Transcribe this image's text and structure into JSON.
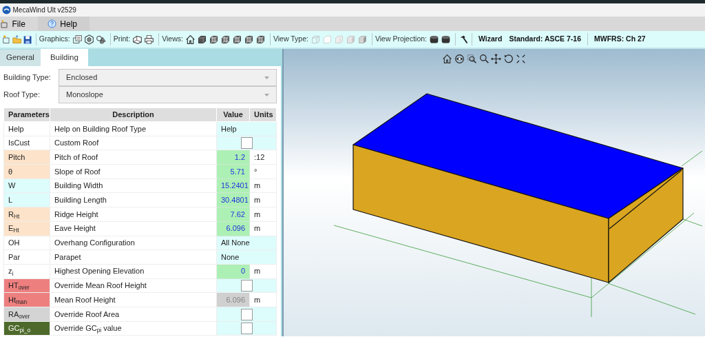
{
  "window": {
    "title": "MecaWind Ult v2529"
  },
  "menu": [
    {
      "label": "File"
    },
    {
      "label": "Help"
    }
  ],
  "toolbar": {
    "groups": [
      {
        "label": "Graphics:"
      },
      {
        "label": "Print:"
      },
      {
        "label": "Views:"
      },
      {
        "label": "View Type:"
      },
      {
        "label": "View Projection:"
      }
    ],
    "text_buttons": [
      "Wizard",
      "Standard: ASCE 7-16",
      "MWFRS: Ch 27"
    ]
  },
  "tabs": [
    {
      "label": "General",
      "selected": false
    },
    {
      "label": "Building",
      "selected": true
    }
  ],
  "fields": [
    {
      "label": "Building Type:",
      "value": "Enclosed"
    },
    {
      "label": "Roof Type:",
      "value": "Monoslope"
    }
  ],
  "table": {
    "columns": [
      "Parameters",
      "Description",
      "Value",
      "Units"
    ],
    "rows": [
      {
        "param": "Help",
        "desc": "Help on Building Roof Type",
        "kind": "text",
        "value": "Help"
      },
      {
        "param": "IsCust",
        "desc": "Custom Roof",
        "kind": "checkbox",
        "checked": false
      },
      {
        "param": "Pitch",
        "color": "#fde3c9",
        "desc": "Pitch of Roof",
        "kind": "number",
        "value": "1.2",
        "units": ":12"
      },
      {
        "param": "θ",
        "color": "#fde3c9",
        "desc": "Slope of Roof",
        "kind": "number",
        "value": "5.71",
        "units": "°"
      },
      {
        "param": "W",
        "color": "#ddfcfc",
        "desc": "Building Width",
        "kind": "number",
        "value": "15.2401",
        "units": "m"
      },
      {
        "param": "L",
        "color": "#ddfcfc",
        "desc": "Building Length",
        "kind": "number",
        "value": "30.4801",
        "units": "m"
      },
      {
        "param": "R$_{Ht}$",
        "color": "#fde3c9",
        "desc": "Ridge Height",
        "kind": "number",
        "value": "7.62",
        "units": "m"
      },
      {
        "param": "E$_{Ht}$",
        "color": "#fde3c9",
        "desc": "Eave Height",
        "kind": "number",
        "value": "6.096",
        "units": "m"
      },
      {
        "param": "OH",
        "desc": "Overhang Configuration",
        "kind": "text",
        "value": "All None"
      },
      {
        "param": "Par",
        "desc": "Parapet",
        "kind": "text",
        "value": "None"
      },
      {
        "param": "z$_{i}$",
        "desc": "Highest Opening Elevation",
        "kind": "number",
        "value": "0",
        "units": "m"
      },
      {
        "param": "HT$_{over}$",
        "color": "#ee7f7f",
        "desc": "Override Mean Roof Height",
        "kind": "checkbox",
        "checked": false
      },
      {
        "param": "Ht$_{man}$",
        "color": "#ee7f7f",
        "desc": "Mean Roof Height",
        "kind": "readonly",
        "value": "6.096",
        "units": "m"
      },
      {
        "param": "RA$_{over}$",
        "color": "#d4d4d4",
        "desc": "Override Roof Area",
        "kind": "checkbox",
        "checked": false
      },
      {
        "param": "GC$_{pi_o}$",
        "color": "#4e6a2b",
        "desc": "Override GC$_{pi}$ value",
        "kind": "checkbox",
        "checked": false
      }
    ]
  }
}
